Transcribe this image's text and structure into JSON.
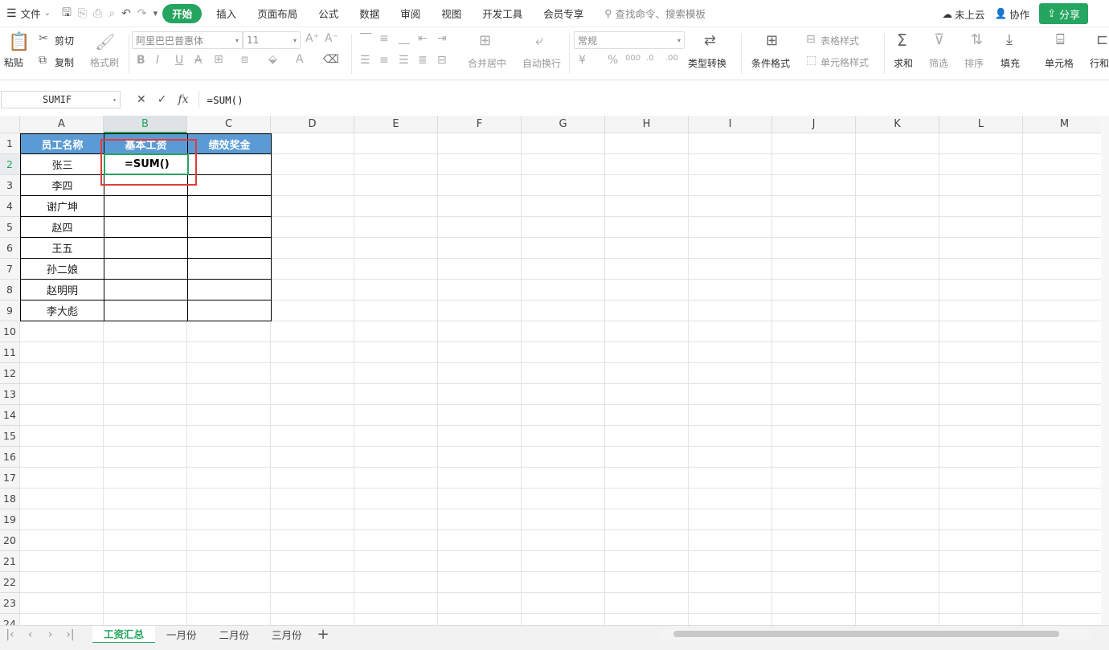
{
  "menubar": {
    "file_label": "文件",
    "tabs": [
      "开始",
      "插入",
      "页面布局",
      "公式",
      "数据",
      "审阅",
      "视图",
      "开发工具",
      "会员专享"
    ],
    "search_placeholder": "查找命令、搜索模板",
    "cloud_label": "未上云",
    "collab_label": "协作",
    "share_label": "分享"
  },
  "ribbon": {
    "paste": "粘贴",
    "cut": "剪切",
    "copy": "复制",
    "format_painter": "格式刷",
    "font_name": "阿里巴巴普惠体",
    "font_size": "11",
    "merge_center": "合并居中",
    "wrap_text": "自动换行",
    "number_format": "常规",
    "type_convert": "类型转换",
    "cond_format": "条件格式",
    "table_style": "表格样式",
    "cell_style": "单元格样式",
    "sum": "求和",
    "filter": "筛选",
    "sort": "排序",
    "fill": "填充",
    "cell": "单元格",
    "row_col": "行和"
  },
  "formula_bar": {
    "name_box": "SUMIF",
    "fx_label": "fx",
    "formula": "=SUM()"
  },
  "grid": {
    "columns": [
      "A",
      "B",
      "C",
      "D",
      "E",
      "F",
      "G",
      "H",
      "I",
      "J",
      "K",
      "L",
      "M"
    ],
    "rows": [
      "1",
      "2",
      "3",
      "4",
      "5",
      "6",
      "7",
      "8",
      "9",
      "10",
      "11",
      "12",
      "13",
      "14",
      "15",
      "16",
      "17",
      "18",
      "19",
      "20",
      "21",
      "22",
      "23",
      "24"
    ],
    "headers": [
      "员工名称",
      "基本工资",
      "绩效奖金"
    ],
    "names": [
      "张三",
      "李四",
      "谢广坤",
      "赵四",
      "王五",
      "孙二娘",
      "赵明明",
      "李大彪"
    ],
    "active_cell_text": "=SUM()"
  },
  "sheet_tabs": [
    "工资汇总",
    "一月份",
    "二月份",
    "三月份"
  ],
  "colors": {
    "accent": "#25a55f",
    "header_fill": "#5b9bd5",
    "highlight": "#e23b3b"
  }
}
